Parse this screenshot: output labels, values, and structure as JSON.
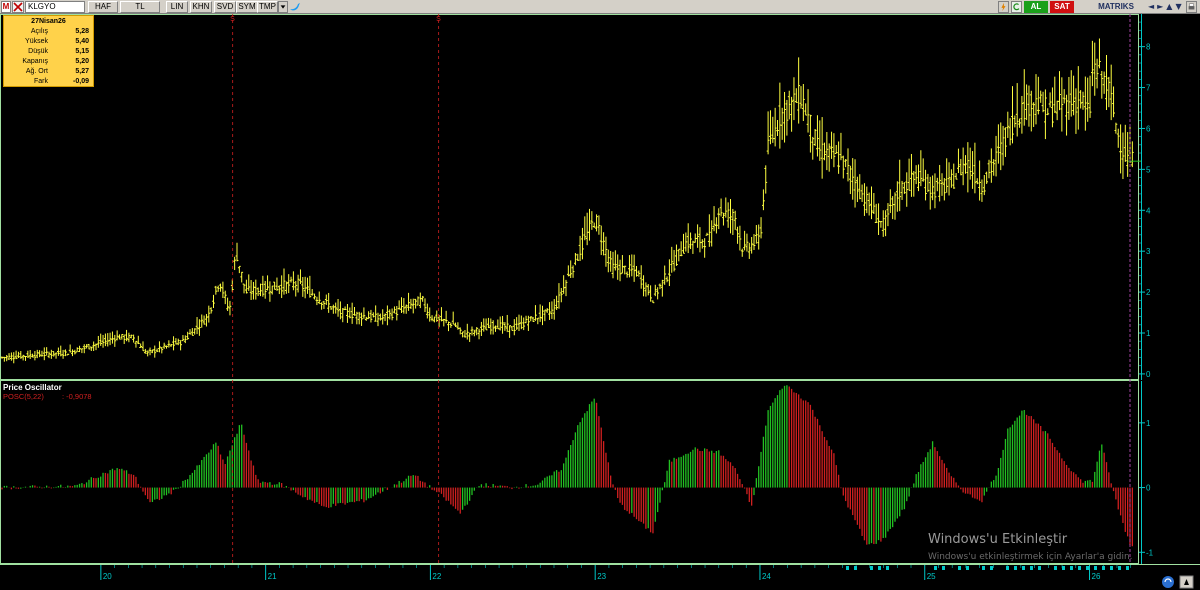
{
  "toolbar": {
    "logo": "M",
    "symbol": "KLGYO",
    "buttons": [
      "HAF",
      "TL",
      "LIN",
      "KHN",
      "SVD",
      "SYM",
      "TMP"
    ],
    "al_label": "AL",
    "sat_label": "SAT",
    "matriks_label": "MATRIKS",
    "nav_arrows": "◄►▲▼",
    "icons": [
      "cancel-icon",
      "dropdown-arrow-icon",
      "twitter-icon",
      "alarm-icon",
      "refresh-icon",
      "print-icon"
    ]
  },
  "infobox": {
    "date": "27Nisan26",
    "rows": [
      {
        "label": "Açılış",
        "value": "5,28"
      },
      {
        "label": "Yüksek",
        "value": "5,40"
      },
      {
        "label": "Düşük",
        "value": "5,15"
      },
      {
        "label": "Kapanış",
        "value": "5,20"
      },
      {
        "label": "Ağ. Ort",
        "value": "5,27"
      },
      {
        "label": "Fark",
        "value": "-0,09"
      }
    ]
  },
  "watermark": {
    "line1": "Windows'u Etkinleştir",
    "line2": "Windows'u etkinleştirmek için Ayarlar'a gidin."
  },
  "colors": {
    "price_bar": "#ffff40",
    "osc_positive": "#22c022",
    "osc_negative": "#d02020",
    "axis": "#00c8c8",
    "panel_border": "#a0e0a0",
    "split_marker": "#d02020"
  },
  "chart_data": [
    {
      "type": "ohlc",
      "x_tick_labels": [
        "20",
        "21",
        "22",
        "23",
        "24",
        "25",
        "26"
      ],
      "y_tick_labels": [
        "0",
        "1",
        "2",
        "3",
        "4",
        "5",
        "6",
        "7",
        "8"
      ],
      "ylim": [
        -0.1,
        8.7
      ],
      "y_ticks": [
        0,
        1,
        2,
        3,
        4,
        5,
        6,
        7,
        8
      ],
      "markers": [
        {
          "label": "S",
          "x": 20.8
        },
        {
          "label": "S",
          "x": 22.05
        }
      ],
      "current_value": 5.2,
      "series_keypoints": [
        [
          19.4,
          0.4
        ],
        [
          19.8,
          0.52
        ],
        [
          20.0,
          0.75
        ],
        [
          20.1,
          0.9
        ],
        [
          20.2,
          0.88
        ],
        [
          20.28,
          0.5
        ],
        [
          20.5,
          0.8
        ],
        [
          20.65,
          1.4
        ],
        [
          20.72,
          2.3
        ],
        [
          20.78,
          1.5
        ],
        [
          20.82,
          3.0
        ],
        [
          20.88,
          2.0
        ],
        [
          21.1,
          2.15
        ],
        [
          21.2,
          2.2
        ],
        [
          21.32,
          1.85
        ],
        [
          21.45,
          1.5
        ],
        [
          21.7,
          1.35
        ],
        [
          21.95,
          1.8
        ],
        [
          22.0,
          1.4
        ],
        [
          22.15,
          1.2
        ],
        [
          22.2,
          0.95
        ],
        [
          22.4,
          1.2
        ],
        [
          22.5,
          1.1
        ],
        [
          22.65,
          1.4
        ],
        [
          22.75,
          1.55
        ],
        [
          22.85,
          2.5
        ],
        [
          22.95,
          3.4
        ],
        [
          23.0,
          3.8
        ],
        [
          23.1,
          2.6
        ],
        [
          23.25,
          2.5
        ],
        [
          23.35,
          1.85
        ],
        [
          23.45,
          2.5
        ],
        [
          23.55,
          3.2
        ],
        [
          23.7,
          3.3
        ],
        [
          23.75,
          4.0
        ],
        [
          23.85,
          3.8
        ],
        [
          23.9,
          3.0
        ],
        [
          24.0,
          3.3
        ],
        [
          24.05,
          5.5
        ],
        [
          24.12,
          6.3
        ],
        [
          24.25,
          6.8
        ],
        [
          24.35,
          5.5
        ],
        [
          24.5,
          5.2
        ],
        [
          24.65,
          4.2
        ],
        [
          24.75,
          3.6
        ],
        [
          24.85,
          4.5
        ],
        [
          24.95,
          4.8
        ],
        [
          25.05,
          4.5
        ],
        [
          25.15,
          4.6
        ],
        [
          25.25,
          5.2
        ],
        [
          25.35,
          4.6
        ],
        [
          25.45,
          5.4
        ],
        [
          25.55,
          6.3
        ],
        [
          25.65,
          6.7
        ],
        [
          25.75,
          6.4
        ],
        [
          25.85,
          6.6
        ],
        [
          25.95,
          6.7
        ],
        [
          26.0,
          6.3
        ],
        [
          26.02,
          7.5
        ],
        [
          26.07,
          7.3
        ],
        [
          26.12,
          6.9
        ],
        [
          26.17,
          5.9
        ],
        [
          26.22,
          5.3
        ],
        [
          26.25,
          5.2
        ]
      ]
    },
    {
      "type": "bar",
      "title": "Price Oscillator",
      "subtitle": "POSC(5,22)",
      "current_value_label": ": -0,9078",
      "y_tick_labels": [
        "1",
        "0",
        "-1"
      ],
      "y_ticks": [
        1,
        0,
        -1
      ],
      "ylim": [
        -1.15,
        1.6
      ],
      "current_value": -0.9078,
      "series_keypoints": [
        [
          19.4,
          0.0
        ],
        [
          19.85,
          0.02
        ],
        [
          20.0,
          0.2
        ],
        [
          20.1,
          0.3
        ],
        [
          20.2,
          0.2
        ],
        [
          20.3,
          -0.25
        ],
        [
          20.45,
          -0.05
        ],
        [
          20.58,
          0.3
        ],
        [
          20.7,
          0.7
        ],
        [
          20.75,
          0.35
        ],
        [
          20.85,
          1.0
        ],
        [
          20.95,
          0.1
        ],
        [
          21.1,
          0.05
        ],
        [
          21.2,
          -0.1
        ],
        [
          21.35,
          -0.3
        ],
        [
          21.6,
          -0.2
        ],
        [
          21.9,
          0.2
        ],
        [
          22.0,
          0.0
        ],
        [
          22.08,
          -0.15
        ],
        [
          22.18,
          -0.4
        ],
        [
          22.3,
          0.05
        ],
        [
          22.5,
          0.0
        ],
        [
          22.65,
          0.05
        ],
        [
          22.8,
          0.3
        ],
        [
          22.9,
          1.0
        ],
        [
          23.0,
          1.4
        ],
        [
          23.1,
          0.1
        ],
        [
          23.15,
          -0.25
        ],
        [
          23.3,
          -0.6
        ],
        [
          23.35,
          -0.7
        ],
        [
          23.45,
          0.4
        ],
        [
          23.6,
          0.6
        ],
        [
          23.75,
          0.55
        ],
        [
          23.85,
          0.3
        ],
        [
          23.95,
          -0.3
        ],
        [
          24.05,
          1.2
        ],
        [
          24.15,
          1.6
        ],
        [
          24.3,
          1.3
        ],
        [
          24.45,
          0.5
        ],
        [
          24.5,
          -0.1
        ],
        [
          24.65,
          -0.9
        ],
        [
          24.75,
          -0.8
        ],
        [
          24.88,
          -0.3
        ],
        [
          24.95,
          0.2
        ],
        [
          25.05,
          0.7
        ],
        [
          25.15,
          0.2
        ],
        [
          25.25,
          -0.1
        ],
        [
          25.35,
          -0.2
        ],
        [
          25.45,
          0.3
        ],
        [
          25.5,
          0.9
        ],
        [
          25.6,
          1.2
        ],
        [
          25.75,
          0.8
        ],
        [
          25.85,
          0.4
        ],
        [
          25.95,
          0.1
        ],
        [
          26.02,
          0.1
        ],
        [
          26.07,
          0.7
        ],
        [
          26.12,
          0.2
        ],
        [
          26.17,
          -0.3
        ],
        [
          26.25,
          -0.91
        ]
      ]
    }
  ]
}
